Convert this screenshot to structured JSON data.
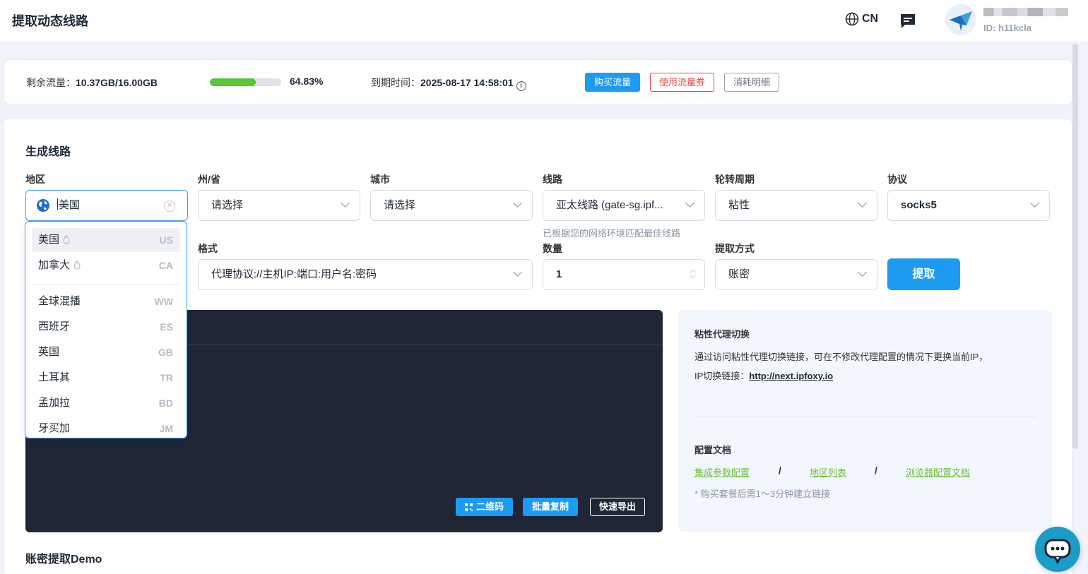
{
  "header": {
    "title": "提取动态线路",
    "language": "CN",
    "user_id": "ID: h11kcla"
  },
  "traffic": {
    "remaining_label": "剩余流量：",
    "remaining_value": "10.37GB/16.00GB",
    "progress_percent": 64.83,
    "progress_text": "64.83%",
    "expiry_label": "到期时间：",
    "expiry_value": "2025-08-17 14:58:01",
    "buy_label": "购买流量",
    "coupon_label": "使用流量券",
    "detail_label": "消耗明细"
  },
  "form": {
    "section_title": "生成线路",
    "region": {
      "label": "地区",
      "value": "美国"
    },
    "state": {
      "label": "州/省",
      "value": "请选择"
    },
    "city": {
      "label": "城市",
      "value": "请选择"
    },
    "route": {
      "label": "线路",
      "value": "亚太线路 (gate-sg.ipf...",
      "hint": "已根据您的网络环境匹配最佳线路"
    },
    "rotation": {
      "label": "轮转周期",
      "value": "粘性"
    },
    "protocol": {
      "label": "协议",
      "value": "socks5"
    },
    "format": {
      "label": "格式",
      "value": "代理协议://主机IP:端口:用户名:密码"
    },
    "quantity": {
      "label": "数量",
      "value": "1"
    },
    "method": {
      "label": "提取方式",
      "value": "账密"
    },
    "extract_label": "提取"
  },
  "output": {
    "qr_label": "二维码",
    "copy_label": "批量复制",
    "export_label": "快速导出"
  },
  "info": {
    "sticky_title": "粘性代理切换",
    "sticky_desc": "通过访问粘性代理切换链接，可在不修改代理配置的情况下更换当前IP，",
    "switch_label": "IP切换链接：",
    "switch_url": "http://next.ipfoxy.io",
    "docs_title": "配置文档",
    "doc_links": [
      "集成参数配置",
      "地区列表",
      "浏览器配置文档"
    ],
    "separator": "/",
    "note": "* 购买套餐后需1～3分钟建立链接"
  },
  "demo_title": "账密提取Demo",
  "dropdown": {
    "hot": [
      {
        "name": "美国",
        "code": "US"
      },
      {
        "name": "加拿大",
        "code": "CA"
      }
    ],
    "others": [
      {
        "name": "全球混播",
        "code": "WW"
      },
      {
        "name": "西班牙",
        "code": "ES"
      },
      {
        "name": "英国",
        "code": "GB"
      },
      {
        "name": "土耳其",
        "code": "TR"
      },
      {
        "name": "孟加拉",
        "code": "BD"
      },
      {
        "name": "牙买加",
        "code": "JM"
      }
    ]
  },
  "colors": {
    "primary": "#1d9bf0",
    "progress": "#5ac63a",
    "danger": "#ef4444",
    "output_bg": "#1f2636",
    "doc_link": "#6bbf3a"
  }
}
